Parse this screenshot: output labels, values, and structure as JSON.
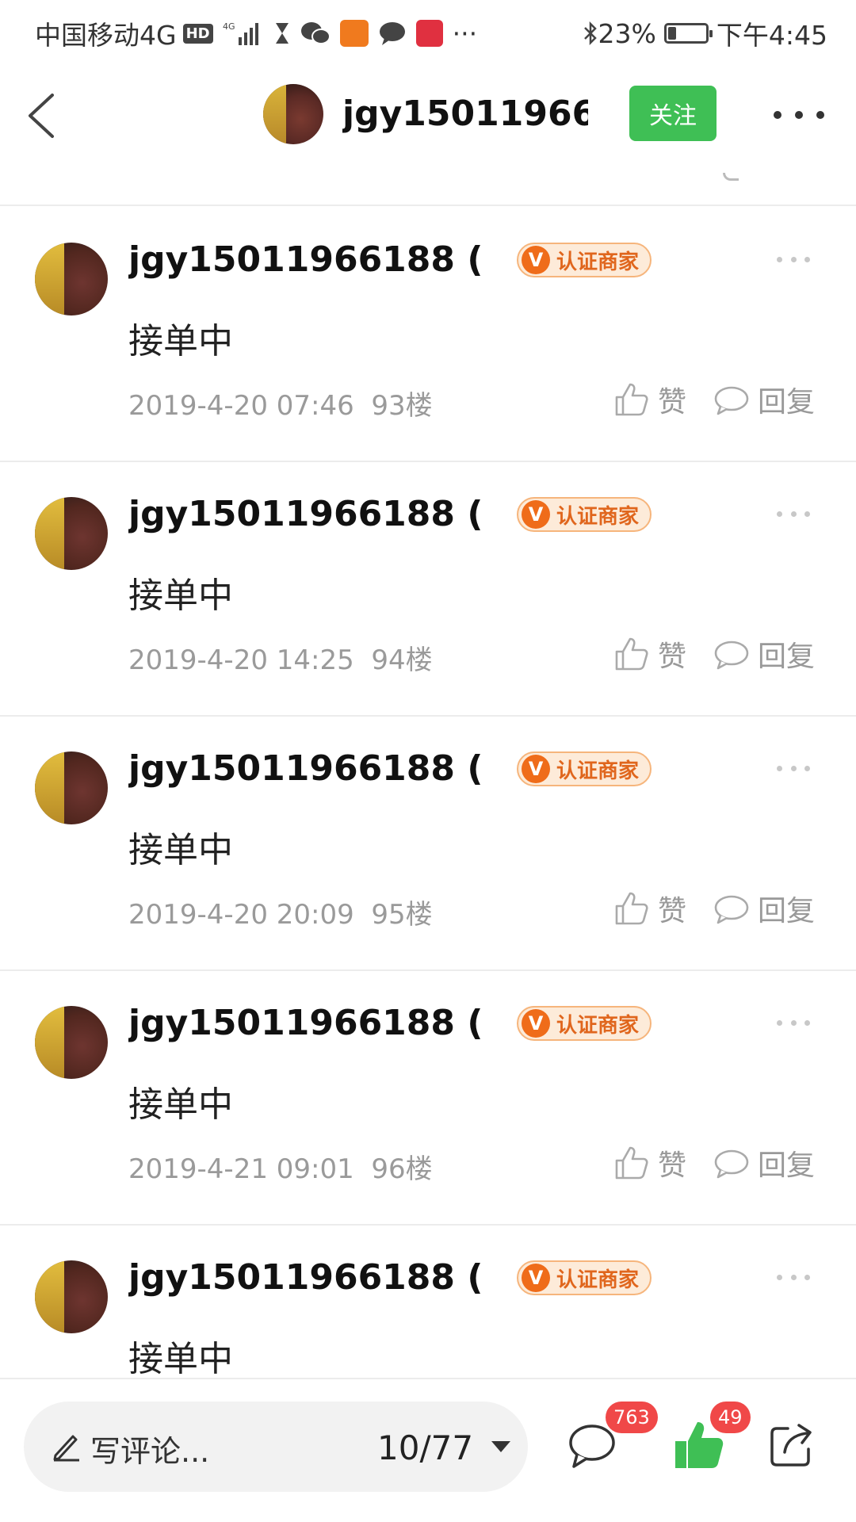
{
  "status_bar": {
    "carrier": "中国移动4G",
    "hd": "HD",
    "bluetooth_battery": "23%",
    "battery_level_percent": 23,
    "time": "下午4:45",
    "more_indicator": "···",
    "icons": [
      "hd-icon",
      "signal-icon",
      "hourglass-icon",
      "wechat-icon",
      "app-orange-icon",
      "message-icon",
      "tmall-icon",
      "bluetooth-icon",
      "battery-icon"
    ]
  },
  "nav": {
    "title": "jgy15011966...",
    "follow_label": "关注",
    "icons": [
      "back-arrow-icon",
      "avatar",
      "more-dots-icon"
    ]
  },
  "posts": [
    {
      "author": "jgy15011966188 (...",
      "badge_v": "V",
      "badge_label": "认证商家",
      "content": "接单中",
      "date": "2019-4-20 07:46",
      "floor": "93楼",
      "like_label": "赞",
      "reply_label": "回复"
    },
    {
      "author": "jgy15011966188 (...",
      "badge_v": "V",
      "badge_label": "认证商家",
      "content": "接单中",
      "date": "2019-4-20 14:25",
      "floor": "94楼",
      "like_label": "赞",
      "reply_label": "回复"
    },
    {
      "author": "jgy15011966188 (...",
      "badge_v": "V",
      "badge_label": "认证商家",
      "content": "接单中",
      "date": "2019-4-20 20:09",
      "floor": "95楼",
      "like_label": "赞",
      "reply_label": "回复"
    },
    {
      "author": "jgy15011966188 (...",
      "badge_v": "V",
      "badge_label": "认证商家",
      "content": "接单中",
      "date": "2019-4-21 09:01",
      "floor": "96楼",
      "like_label": "赞",
      "reply_label": "回复"
    },
    {
      "author": "jgy15011966188 (...",
      "badge_v": "V",
      "badge_label": "认证商家",
      "content": "接单中"
    }
  ],
  "bottom_bar": {
    "comment_placeholder": "写评论...",
    "page_indicator": "10/77",
    "comment_count": "763",
    "like_count": "49",
    "icons": [
      "pen-icon",
      "caret-down-icon",
      "comment-bubble-icon",
      "thumbs-up-icon",
      "share-icon"
    ]
  },
  "colors": {
    "follow_green": "#3fbf55",
    "badge_orange": "#ef6c1a",
    "count_red": "#f04848",
    "like_green": "#3fbf55"
  }
}
